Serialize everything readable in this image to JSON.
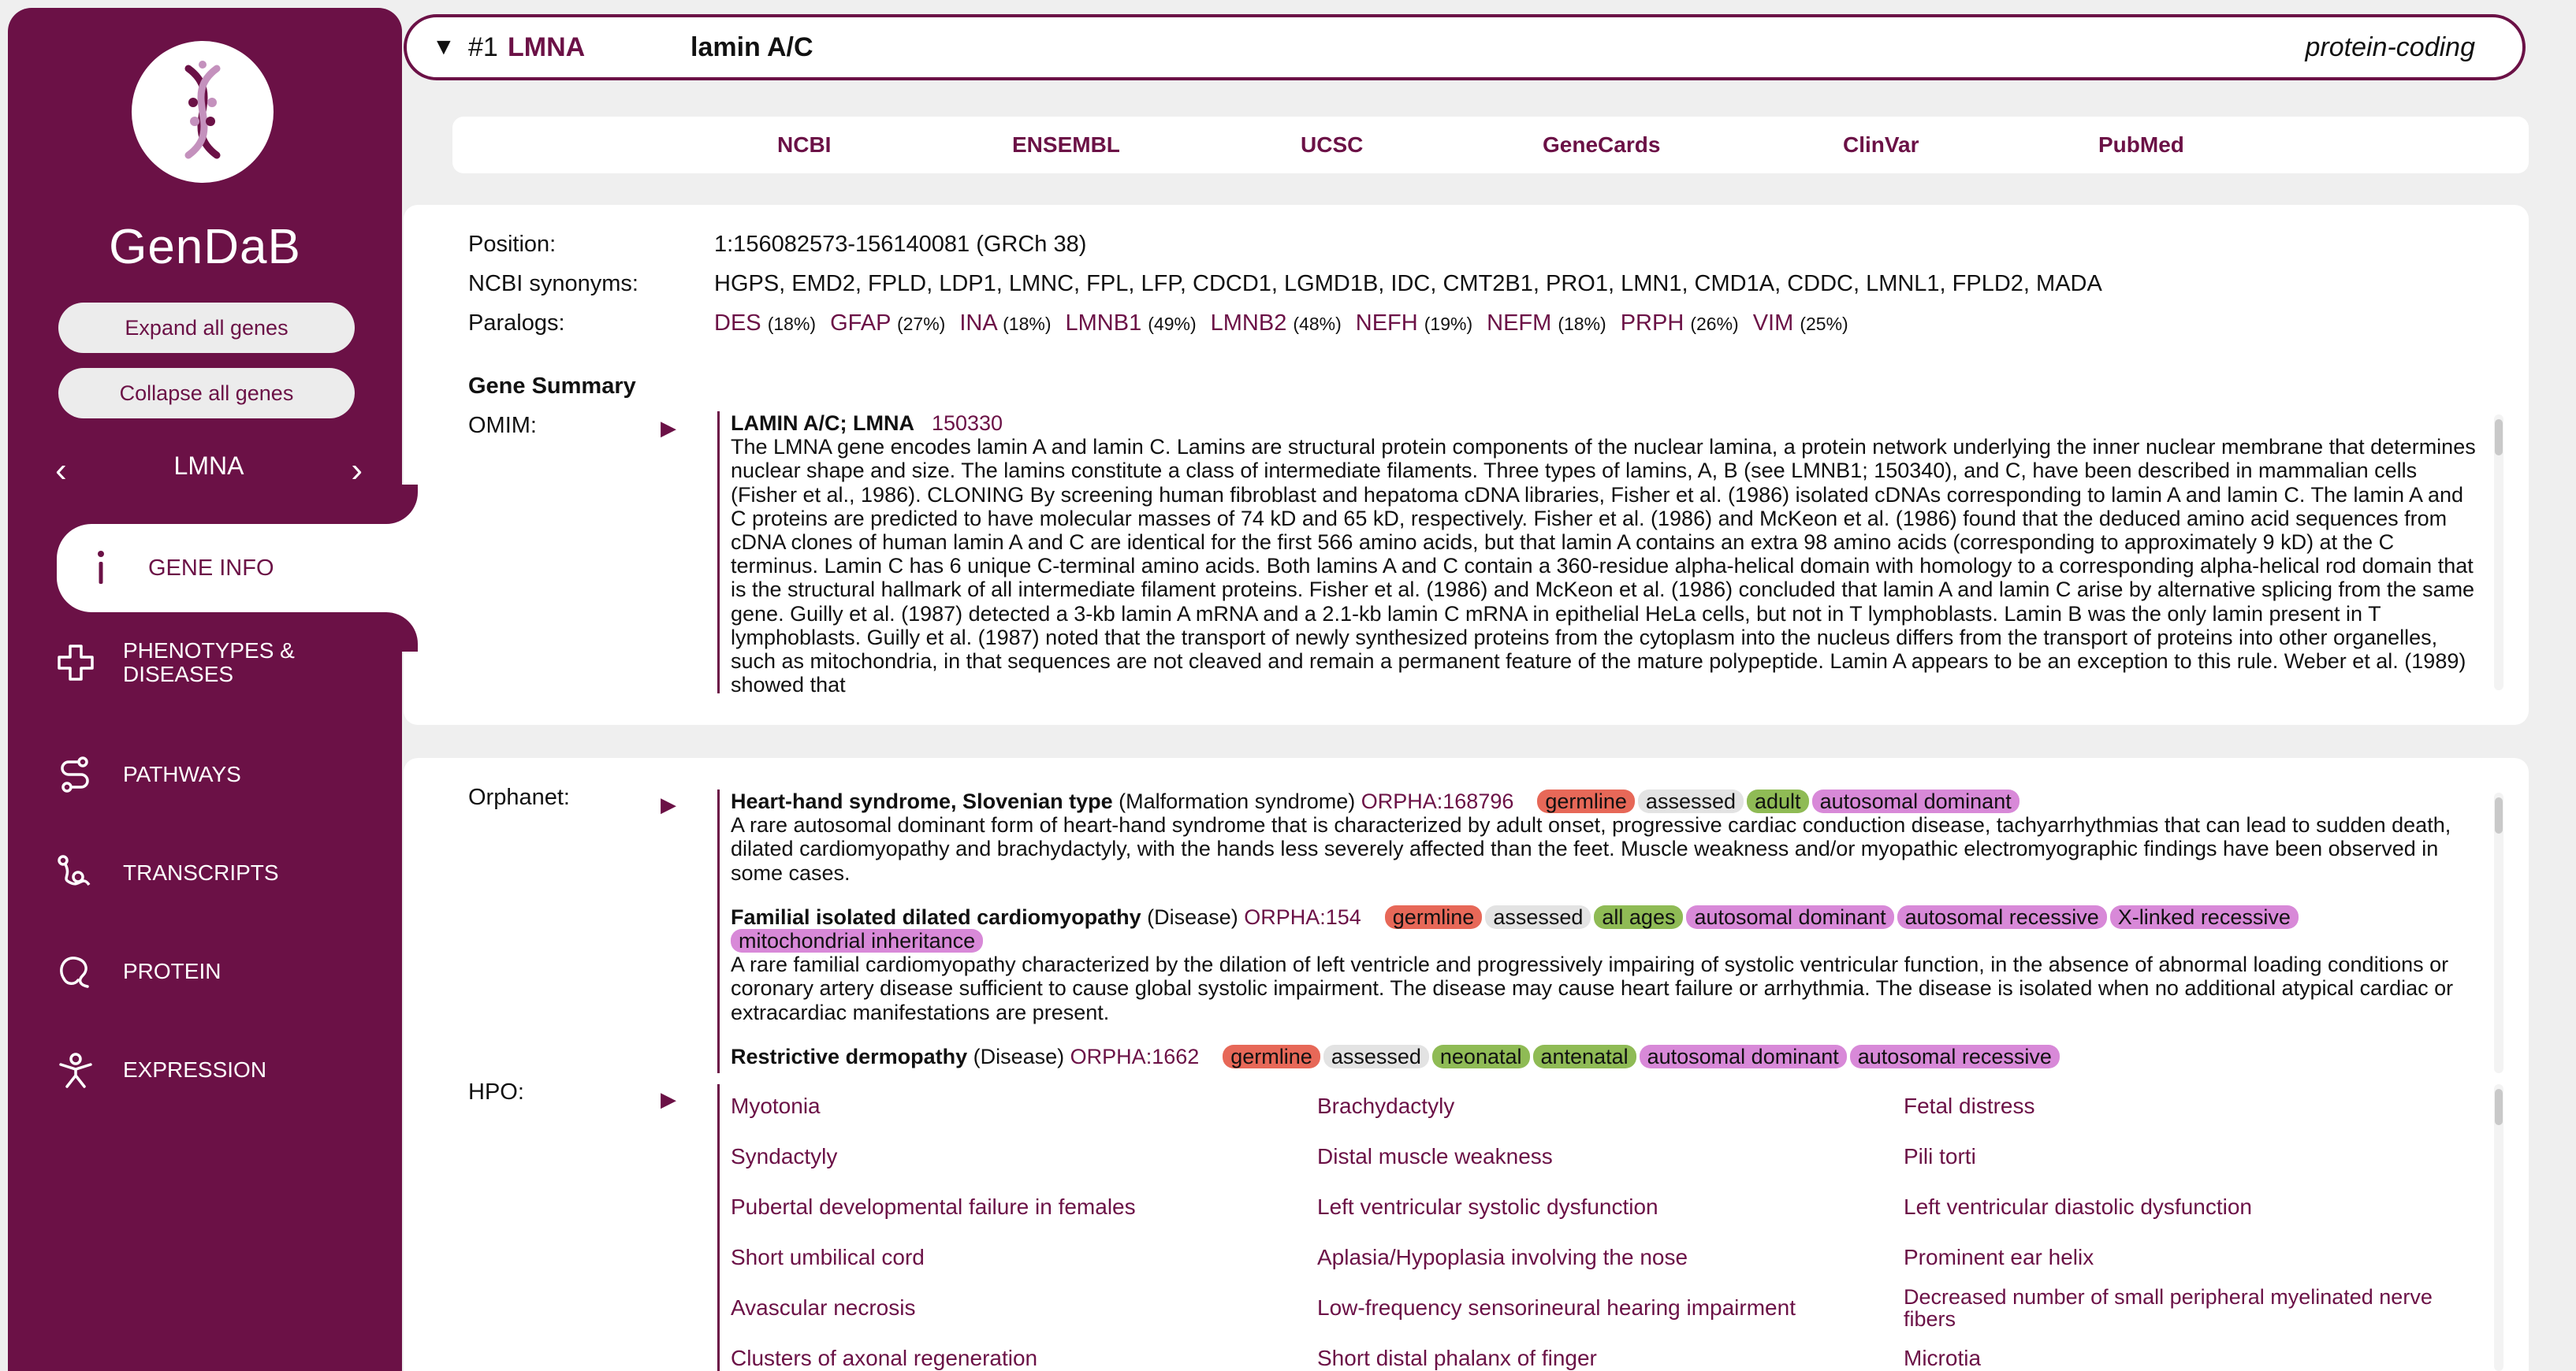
{
  "sidebar": {
    "app_name": "GenDaB",
    "expand_label": "Expand all genes",
    "collapse_label": "Collapse all genes",
    "nav_gene": "LMNA",
    "prev_icon": "chevron-left-icon",
    "next_icon": "chevron-right-icon",
    "items": [
      {
        "label": "GENE INFO",
        "icon": "info-icon"
      },
      {
        "label": "PHENOTYPES & DISEASES",
        "icon": "medical-cross-icon"
      },
      {
        "label": "PATHWAYS",
        "icon": "pathway-icon"
      },
      {
        "label": "TRANSCRIPTS",
        "icon": "transcript-icon"
      },
      {
        "label": "PROTEIN",
        "icon": "protein-icon"
      },
      {
        "label": "EXPRESSION",
        "icon": "person-icon"
      }
    ]
  },
  "header": {
    "toggle": "▼",
    "rank": "#1",
    "symbol": "LMNA",
    "full_name": "lamin A/C",
    "gene_type": "protein-coding"
  },
  "links": [
    "NCBI",
    "ENSEMBL",
    "UCSC",
    "GeneCards",
    "ClinVar",
    "PubMed"
  ],
  "gene_info": {
    "position_label": "Position:",
    "position": "1:156082573-156140081 (GRCh 38)",
    "synonyms_label": "NCBI synonyms:",
    "synonyms": "HGPS, EMD2, FPLD, LDP1, LMNC, FPL, LFP, CDCD1, LGMD1B, IDC, CMT2B1, PRO1, LMN1, CMD1A, CDDC, LMNL1, FPLD2, MADA",
    "paralogs_label": "Paralogs:",
    "paralogs": [
      {
        "name": "DES",
        "pct": "(18%)"
      },
      {
        "name": "GFAP",
        "pct": "(27%)"
      },
      {
        "name": "INA",
        "pct": "(18%)"
      },
      {
        "name": "LMNB1",
        "pct": "(49%)"
      },
      {
        "name": "LMNB2",
        "pct": "(48%)"
      },
      {
        "name": "NEFH",
        "pct": "(19%)"
      },
      {
        "name": "NEFM",
        "pct": "(18%)"
      },
      {
        "name": "PRPH",
        "pct": "(26%)"
      },
      {
        "name": "VIM",
        "pct": "(25%)"
      }
    ],
    "summary_label": "Gene Summary",
    "omim_label": "OMIM:",
    "omim_title": "LAMIN A/C; LMNA",
    "omim_id": "150330",
    "omim_text": "The LMNA gene encodes lamin A and lamin C. Lamins are structural protein components of the nuclear lamina, a protein network underlying the inner nuclear membrane that determines nuclear shape and size. The lamins constitute a class of intermediate filaments. Three types of lamins, A, B (see LMNB1; 150340), and C, have been described in mammalian cells (Fisher et al., 1986). CLONING By screening human fibroblast and hepatoma cDNA libraries, Fisher et al. (1986) isolated cDNAs corresponding to lamin A and lamin C. The lamin A and C proteins are predicted to have molecular masses of 74 kD and 65 kD, respectively. Fisher et al. (1986) and McKeon et al. (1986) found that the deduced amino acid sequences from cDNA clones of human lamin A and C are identical for the first 566 amino acids, but that lamin A contains an extra 98 amino acids (corresponding to approximately 9 kD) at the C terminus. Lamin C has 6 unique C-terminal amino acids. Both lamins A and C contain a 360-residue alpha-helical domain with homology to a corresponding alpha-helical rod domain that is the structural hallmark of all intermediate filament proteins. Fisher et al. (1986) and McKeon et al. (1986) concluded that lamin A and lamin C arise by alternative splicing from the same gene. Guilly et al. (1987) detected a 3-kb lamin A mRNA and a 2.1-kb lamin C mRNA in epithelial HeLa cells, but not in T lymphoblasts. Lamin B was the only lamin present in T lymphoblasts. Guilly et al. (1987) noted that the transport of newly synthesized proteins from the cytoplasm into the nucleus differs from the transport of proteins into other organelles, such as mitochondria, in that sequences are not cleaved and remain a permanent feature of the mature polypeptide. Lamin A appears to be an exception to this rule. Weber et al. (1989) showed that"
  },
  "phenotypes": {
    "orphanet_label": "Orphanet:",
    "orphanet": [
      {
        "name": "Heart-hand syndrome, Slovenian type",
        "category": "(Malformation syndrome)",
        "code": "ORPHA:168796",
        "tags": [
          {
            "text": "germline",
            "kind": "germline"
          },
          {
            "text": "assessed",
            "kind": "assessed"
          },
          {
            "text": "adult",
            "kind": "age"
          },
          {
            "text": "autosomal dominant",
            "kind": "inh"
          }
        ],
        "description": "A rare autosomal dominant form of heart-hand syndrome that is characterized by adult onset, progressive cardiac conduction disease, tachyarrhythmias that can lead to sudden death, dilated cardiomyopathy and brachydactyly, with the hands less severely affected than the feet. Muscle weakness and/or myopathic electromyographic findings have been observed in some cases."
      },
      {
        "name": "Familial isolated dilated cardiomyopathy",
        "category": "(Disease)",
        "code": "ORPHA:154",
        "tags": [
          {
            "text": "germline",
            "kind": "germline"
          },
          {
            "text": "assessed",
            "kind": "assessed"
          },
          {
            "text": "all ages",
            "kind": "age"
          },
          {
            "text": "autosomal dominant",
            "kind": "inh"
          },
          {
            "text": "autosomal recessive",
            "kind": "inh"
          },
          {
            "text": "X-linked recessive",
            "kind": "inh"
          },
          {
            "text": "mitochondrial inheritance",
            "kind": "inh"
          }
        ],
        "description": "A rare familial cardiomyopathy characterized by the dilation of left ventricle and progressively impairing of systolic ventricular function, in the absence of abnormal loading conditions or coronary artery disease sufficient to cause global systolic impairment. The disease may cause heart failure or arrhythmia. The disease is isolated when no additional atypical cardiac or extracardiac manifestations are present."
      },
      {
        "name": "Restrictive dermopathy",
        "category": "(Disease)",
        "code": "ORPHA:1662",
        "tags": [
          {
            "text": "germline",
            "kind": "germline"
          },
          {
            "text": "assessed",
            "kind": "assessed"
          },
          {
            "text": "neonatal",
            "kind": "age"
          },
          {
            "text": "antenatal",
            "kind": "age"
          },
          {
            "text": "autosomal dominant",
            "kind": "inh"
          },
          {
            "text": "autosomal recessive",
            "kind": "inh"
          }
        ],
        "description": ""
      }
    ],
    "hpo_label": "HPO:",
    "hpo_columns": [
      [
        "Myotonia",
        "Syndactyly",
        "Pubertal developmental failure in females",
        "Short umbilical cord",
        "Avascular necrosis",
        "Clusters of axonal regeneration"
      ],
      [
        "Brachydactyly",
        "Distal muscle weakness",
        "Left ventricular systolic dysfunction",
        "Aplasia/Hypoplasia involving the nose",
        "Low-frequency sensorineural hearing impairment",
        "Short distal phalanx of finger"
      ],
      [
        "Fetal distress",
        "Pili torti",
        "Left ventricular diastolic dysfunction",
        "Prominent ear helix",
        "Decreased number of small peripheral myelinated nerve fibers",
        "Microtia"
      ]
    ]
  },
  "colors": {
    "brand": "#6b1146",
    "germline": "#e76858",
    "assessed": "#e3e3e3",
    "age": "#8fbb55",
    "inheritance": "#d889d8"
  }
}
